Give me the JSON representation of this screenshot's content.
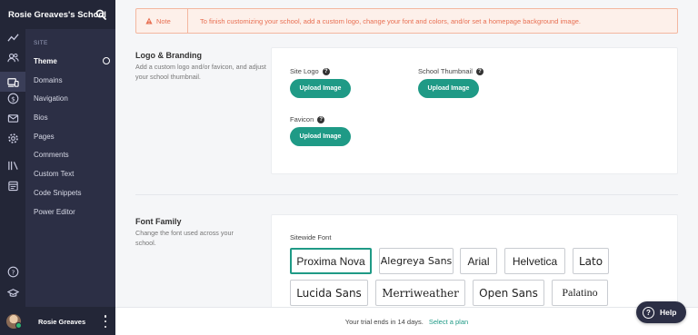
{
  "sidebar": {
    "school_name": "Rosie Greaves's School",
    "section_label": "SITE",
    "items": [
      {
        "label": "Theme",
        "active": true
      },
      {
        "label": "Domains"
      },
      {
        "label": "Navigation"
      },
      {
        "label": "Bios"
      },
      {
        "label": "Pages"
      },
      {
        "label": "Comments"
      },
      {
        "label": "Custom Text"
      },
      {
        "label": "Code Snippets"
      },
      {
        "label": "Power Editor"
      }
    ],
    "rail_icons": [
      "trend-icon",
      "users-icon",
      "devices-icon",
      "dollar-icon",
      "mail-icon",
      "gear-icon",
      "library-icon",
      "calendar-icon",
      "help-circle-icon",
      "graduation-cap-icon"
    ],
    "user_name": "Rosie Greaves"
  },
  "note": {
    "label": "Note",
    "text": "To finish customizing your school, add a custom logo, change your font and colors, and/or set a homepage background image."
  },
  "branding": {
    "title": "Logo & Branding",
    "description": "Add a custom logo and/or favicon, and adjust your school thumbnail.",
    "site_logo_label": "Site Logo",
    "thumbnail_label": "School Thumbnail",
    "favicon_label": "Favicon",
    "upload_label": "Upload Image"
  },
  "font_family": {
    "title": "Font Family",
    "description": "Change the font used across your school.",
    "sitewide_label": "Sitewide Font",
    "options": [
      "Proxima Nova",
      "Alegreya Sans",
      "Arial",
      "Helvetica",
      "Lato",
      "Lucida Sans",
      "Merriweather",
      "Open Sans",
      "Palatino"
    ],
    "selected": "Proxima Nova"
  },
  "trial": {
    "text": "Your trial ends in 14 days.",
    "link": "Select a plan"
  },
  "help_button": {
    "label": "Help"
  },
  "colors": {
    "accent": "#1f9a86",
    "sidebar": "#2c2f45",
    "note": "#e86f52"
  }
}
